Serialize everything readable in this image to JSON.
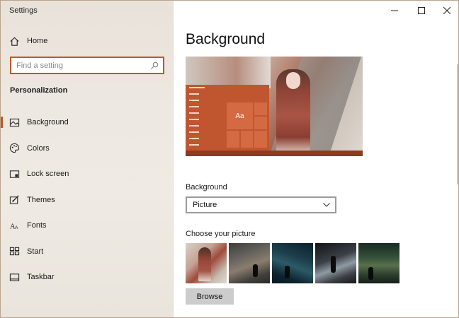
{
  "window": {
    "title": "Settings",
    "controls": [
      "minimize",
      "maximize",
      "close"
    ]
  },
  "sidebar": {
    "home_label": "Home",
    "search_placeholder": "Find a setting",
    "section_title": "Personalization",
    "items": [
      {
        "label": "Background",
        "icon": "picture-icon",
        "active": true
      },
      {
        "label": "Colors",
        "icon": "palette-icon",
        "active": false
      },
      {
        "label": "Lock screen",
        "icon": "lock-screen-icon",
        "active": false
      },
      {
        "label": "Themes",
        "icon": "brush-icon",
        "active": false
      },
      {
        "label": "Fonts",
        "icon": "fonts-icon",
        "active": false
      },
      {
        "label": "Start",
        "icon": "start-icon",
        "active": false
      },
      {
        "label": "Taskbar",
        "icon": "taskbar-icon",
        "active": false
      }
    ]
  },
  "main": {
    "title": "Background",
    "preview": {
      "sample_text": "Aa"
    },
    "background_label": "Background",
    "background_value": "Picture",
    "choose_label": "Choose your picture",
    "browse_label": "Browse"
  },
  "colors": {
    "accent": "#c0562f",
    "sidebar_bg": "#ede8e1",
    "button_bg": "#cccccc"
  }
}
